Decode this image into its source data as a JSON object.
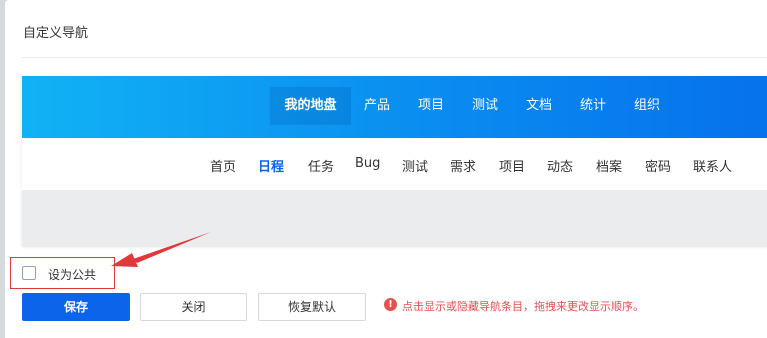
{
  "dialog": {
    "title": "自定义导航"
  },
  "colors": {
    "primary": "#0c64eb",
    "topbar_start": "#11b2f5",
    "topbar_end": "#0671ec",
    "hint": "#e55151",
    "annotation": "#e2383c"
  },
  "top_nav": {
    "items": [
      "我的地盘",
      "产品",
      "项目",
      "测试",
      "文档",
      "统计",
      "组织"
    ],
    "active": "我的地盘"
  },
  "sub_nav": {
    "items": [
      "首页",
      "日程",
      "任务",
      "Bug",
      "测试",
      "需求",
      "项目",
      "动态",
      "档案",
      "密码",
      "联系人"
    ],
    "active": "日程"
  },
  "options": {
    "set_public_label": "设为公共",
    "set_public_checked": false
  },
  "buttons": {
    "save": "保存",
    "close": "关闭",
    "restore_default": "恢复默认"
  },
  "hint": {
    "icon": "exclamation-circle-icon",
    "text": "点击显示或隐藏导航条目，拖拽来更改显示顺序。"
  }
}
